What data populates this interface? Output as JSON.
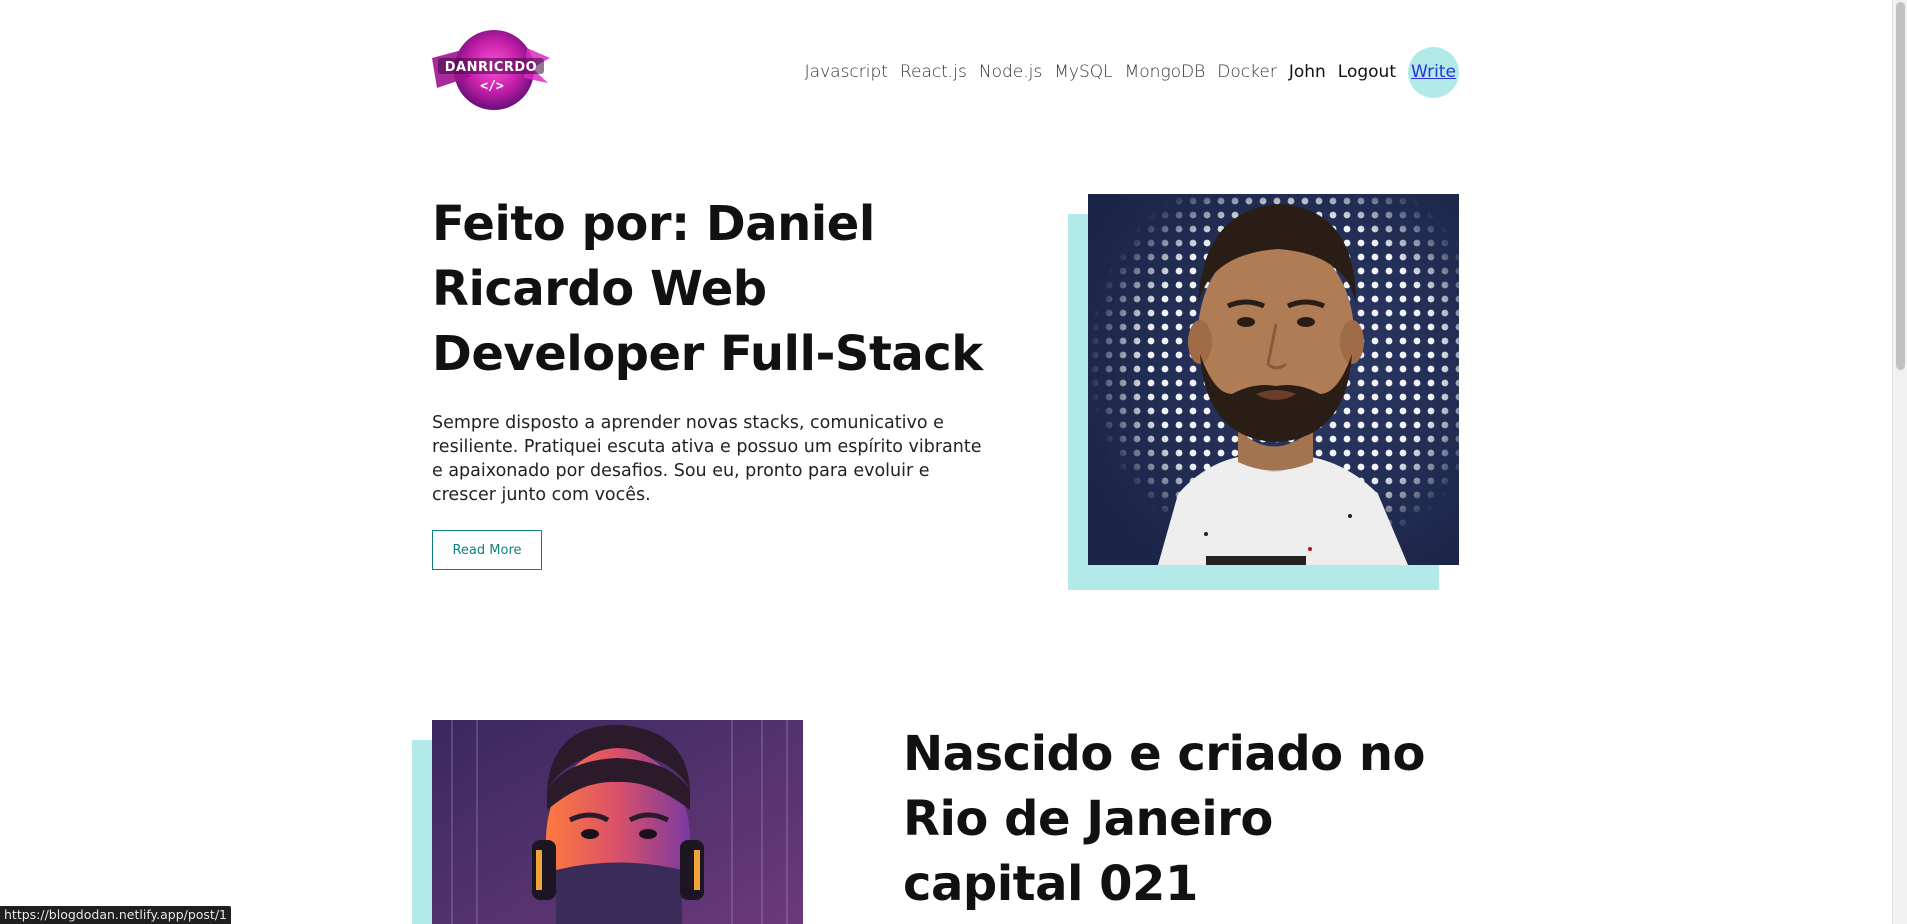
{
  "logo": {
    "text": "DANRICRDO",
    "code": "</>"
  },
  "nav": {
    "links": [
      "Javascript",
      "React.js",
      "Node.js",
      "MySQL",
      "MongoDB",
      "Docker"
    ],
    "user": "John",
    "logout": "Logout",
    "write": "Write"
  },
  "hero": {
    "title": "Feito por: Daniel Ricardo Web Developer Full-Stack",
    "description": "Sempre disposto a aprender novas stacks, comunicativo e resiliente. Pratiquei escuta ativa e possuo um espírito vibrante e apaixonado por desafios. Sou eu, pronto para evoluir e crescer junto com vocês.",
    "read_more": "Read More"
  },
  "second": {
    "title": "Nascido e criado no Rio de Janeiro capital 021"
  },
  "status_bar": {
    "url": "https://blogdodan.netlify.app/post/1"
  },
  "colors": {
    "accent": "#b2eaea",
    "button_border": "#0f7f7f",
    "link_blue": "#2a32d6"
  }
}
